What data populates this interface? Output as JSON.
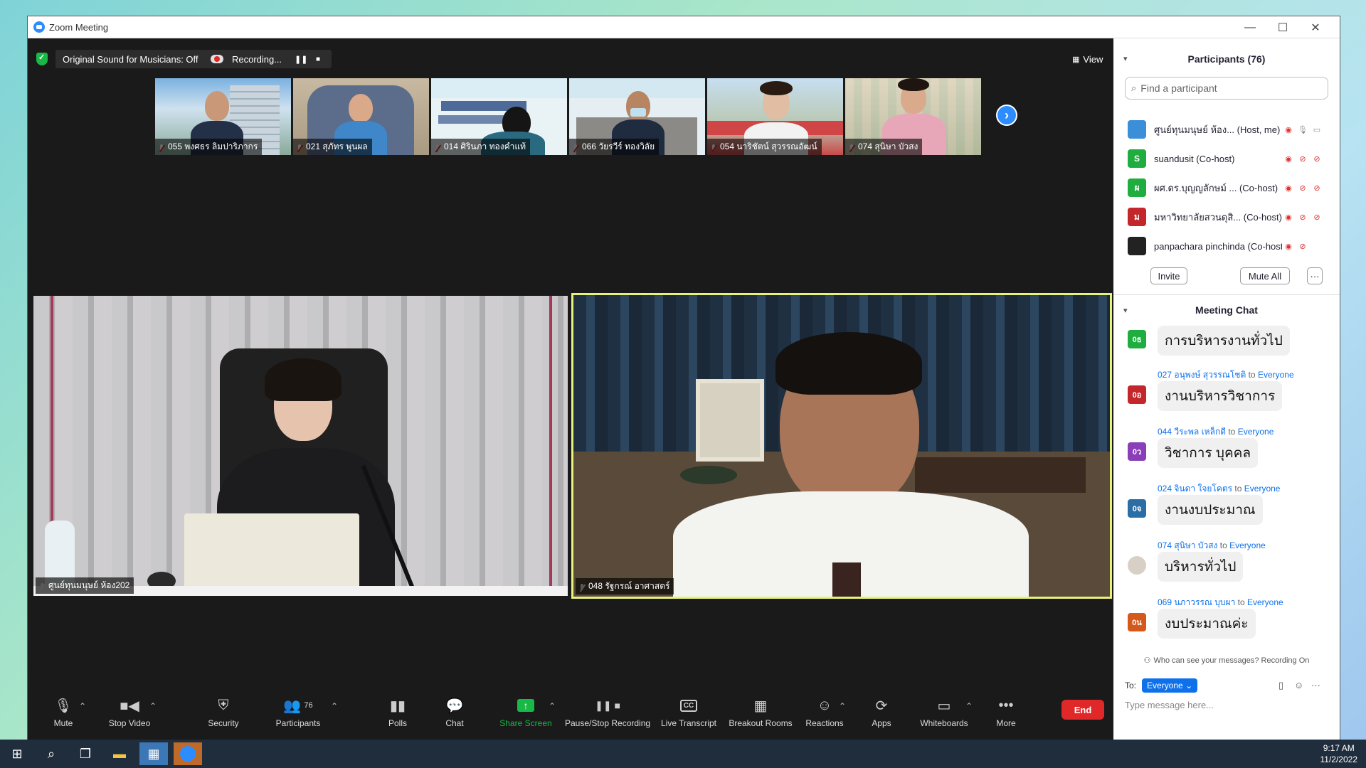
{
  "window": {
    "title": "Zoom Meeting"
  },
  "topbar": {
    "original_sound": "Original Sound for Musicians: Off",
    "recording": "Recording...",
    "view": "View"
  },
  "thumbnails": [
    {
      "name": "055 พงศธร ลิมปาริภากร"
    },
    {
      "name": "021 สุภัทร พูนผล"
    },
    {
      "name": "014 ศิรินภา ทองคำแท้"
    },
    {
      "name": "066 วัยรวีร์ ทองวิลัย"
    },
    {
      "name": "054 นาริชัตน์  สุวรรณอัฒน์"
    },
    {
      "name": "074 สุนิษา  บัวสง"
    }
  ],
  "main_tiles": {
    "left_name": "ศูนย์ทุนมนุษย์ ห้อง202",
    "right_name": "048 รัฐกรณ์ อาศาสตร์"
  },
  "toolbar": {
    "mute": "Mute",
    "stop_video": "Stop Video",
    "security": "Security",
    "participants": "Participants",
    "participants_count": "76",
    "polls": "Polls",
    "chat": "Chat",
    "share_screen": "Share Screen",
    "pause_stop_recording": "Pause/Stop Recording",
    "live_transcript": "Live Transcript",
    "breakout_rooms": "Breakout Rooms",
    "reactions": "Reactions",
    "apps": "Apps",
    "whiteboards": "Whiteboards",
    "more": "More",
    "end": "End"
  },
  "participants_panel": {
    "title": "Participants (76)",
    "search_placeholder": "Find a participant",
    "items": [
      {
        "name": "ศูนย์ทุนมนุษย์ ห้อง... (Host, me)",
        "avatar": "",
        "color": "#3a8fd8"
      },
      {
        "name": "suandusit (Co-host)",
        "avatar": "S",
        "color": "#1fad3f"
      },
      {
        "name": "ผศ.ดร.บุญญลักษม์ ... (Co-host)",
        "avatar": "ผ",
        "color": "#1fad3f"
      },
      {
        "name": "มหาวิทยาลัยสวนดุสิ... (Co-host)",
        "avatar": "ม",
        "color": "#c3272b"
      },
      {
        "name": "panpachara pinchinda (Co-host)",
        "avatar": "",
        "color": "#222222"
      }
    ],
    "invite": "Invite",
    "mute_all": "Mute All",
    "more": "···"
  },
  "chat_panel": {
    "title": "Meeting Chat",
    "messages": [
      {
        "sender": "",
        "to": "",
        "text": "การบริหารงานทั่วไป",
        "avatar": "0ธ",
        "color": "#1fad3f"
      },
      {
        "sender": "027 อนุพงษ์ สุวรรณโชติ",
        "to": "Everyone",
        "text": "งานบริหารวิชาการ",
        "avatar": "0อ",
        "color": "#c3272b"
      },
      {
        "sender": "044 วีระพล เหล็กดี",
        "to": "Everyone",
        "text": "วิชาการ บุคคล",
        "avatar": "0ว",
        "color": "#8a3fb8"
      },
      {
        "sender": "024 จินดา ใจยโคตร",
        "to": "Everyone",
        "text": "งานงบประมาณ",
        "avatar": "0จ",
        "color": "#2b6ea6"
      },
      {
        "sender": "074 สุนิษา  บัวสง",
        "to": "Everyone",
        "text": "บริหารทั่วไป",
        "avatar": "",
        "color": "#888888"
      },
      {
        "sender": "069 นภาวรรณ บุบผา",
        "to": "Everyone",
        "text": "งบประมาณค่ะ",
        "avatar": "0น",
        "color": "#d45a1c"
      }
    ],
    "who_can_see": "Who can see your messages? Recording On",
    "to_label": "To:",
    "to_value": "Everyone",
    "input_placeholder": "Type message here..."
  },
  "taskbar": {
    "time": "9:17 AM",
    "date": "11/2/2022"
  }
}
